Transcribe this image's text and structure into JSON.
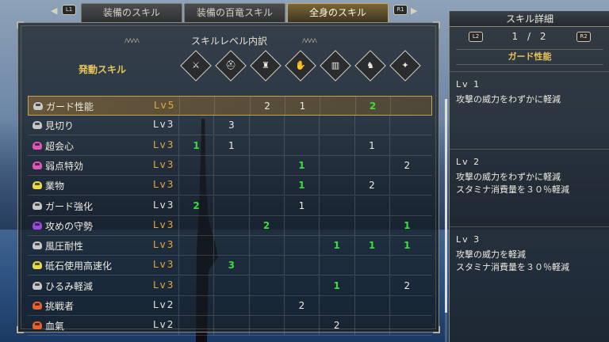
{
  "tabs": {
    "prev_glyph": "L1",
    "next_glyph": "R1",
    "items": [
      {
        "label": "装備のスキル"
      },
      {
        "label": "装備の百竜スキル"
      },
      {
        "label": "全身のスキル",
        "active": true
      }
    ]
  },
  "breakdown": {
    "title": "スキルレベル内訳",
    "activated_label": "発動スキル",
    "equip_icons": [
      "weapon-icon",
      "helm-icon",
      "chest-icon",
      "arms-icon",
      "waist-icon",
      "legs-icon",
      "talisman-icon"
    ]
  },
  "skills": [
    {
      "name": "ガード性能",
      "level": "Lv5",
      "max": true,
      "icon_color": "#c8c8c8",
      "cells": [
        "",
        "",
        "2",
        "1",
        "",
        "2",
        ""
      ],
      "deco": [
        false,
        false,
        false,
        false,
        false,
        true,
        false
      ]
    },
    {
      "name": "見切り",
      "level": "Lv3",
      "max": false,
      "icon_color": "#c8c8c8",
      "cells": [
        "",
        "3",
        "",
        "",
        "",
        "",
        ""
      ],
      "deco": [
        false,
        false,
        false,
        false,
        false,
        false,
        false
      ]
    },
    {
      "name": "超会心",
      "level": "Lv3",
      "max": true,
      "icon_color": "#e055b8",
      "cells": [
        "1",
        "1",
        "",
        "",
        "",
        "1",
        ""
      ],
      "deco": [
        true,
        false,
        false,
        false,
        false,
        false,
        false
      ]
    },
    {
      "name": "弱点特効",
      "level": "Lv3",
      "max": true,
      "icon_color": "#e055b8",
      "cells": [
        "",
        "",
        "",
        "1",
        "",
        "",
        "2"
      ],
      "deco": [
        false,
        false,
        false,
        true,
        false,
        false,
        false
      ]
    },
    {
      "name": "業物",
      "level": "Lv3",
      "max": true,
      "icon_color": "#e8d84a",
      "cells": [
        "",
        "",
        "",
        "1",
        "",
        "2",
        ""
      ],
      "deco": [
        false,
        false,
        false,
        true,
        false,
        false,
        false
      ]
    },
    {
      "name": "ガード強化",
      "level": "Lv3",
      "max": false,
      "icon_color": "#c8c8c8",
      "cells": [
        "2",
        "",
        "",
        "1",
        "",
        "",
        ""
      ],
      "deco": [
        true,
        false,
        false,
        false,
        false,
        false,
        false
      ]
    },
    {
      "name": "攻めの守勢",
      "level": "Lv3",
      "max": true,
      "icon_color": "#9a4ad8",
      "cells": [
        "",
        "",
        "2",
        "",
        "",
        "",
        "1"
      ],
      "deco": [
        false,
        false,
        true,
        false,
        false,
        false,
        true
      ]
    },
    {
      "name": "風圧耐性",
      "level": "Lv3",
      "max": true,
      "icon_color": "#c8c8c8",
      "cells": [
        "",
        "",
        "",
        "",
        "1",
        "1",
        "1"
      ],
      "deco": [
        false,
        false,
        false,
        false,
        true,
        true,
        true
      ]
    },
    {
      "name": "砥石使用高速化",
      "level": "Lv3",
      "max": true,
      "icon_color": "#e8d84a",
      "cells": [
        "",
        "3",
        "",
        "",
        "",
        "",
        ""
      ],
      "deco": [
        false,
        true,
        false,
        false,
        false,
        false,
        false
      ]
    },
    {
      "name": "ひるみ軽減",
      "level": "Lv3",
      "max": true,
      "icon_color": "#c8c8c8",
      "cells": [
        "",
        "",
        "",
        "",
        "1",
        "",
        "2"
      ],
      "deco": [
        false,
        false,
        false,
        false,
        true,
        false,
        false
      ]
    },
    {
      "name": "挑戦者",
      "level": "Lv2",
      "max": false,
      "icon_color": "#e8602a",
      "cells": [
        "",
        "",
        "",
        "2",
        "",
        "",
        ""
      ],
      "deco": [
        false,
        false,
        false,
        false,
        false,
        false,
        false
      ]
    },
    {
      "name": "血氣",
      "level": "Lv2",
      "max": false,
      "icon_color": "#e8602a",
      "cells": [
        "",
        "",
        "",
        "",
        "2",
        "",
        ""
      ],
      "deco": [
        false,
        false,
        false,
        false,
        false,
        false,
        false
      ]
    }
  ],
  "detail": {
    "header": "スキル詳細",
    "prev_glyph": "L2",
    "next_glyph": "R2",
    "page": "1 / 2",
    "skill_name": "ガード性能",
    "levels": [
      {
        "title": "Lv 1",
        "desc": [
          "攻撃の威力をわずかに軽減"
        ]
      },
      {
        "title": "Lv 2",
        "desc": [
          "攻撃の威力をわずかに軽減",
          "スタミナ消費量を３０％軽減"
        ]
      },
      {
        "title": "Lv 3",
        "desc": [
          "攻撃の威力を軽減",
          "スタミナ消費量を３０％軽減"
        ]
      }
    ]
  }
}
